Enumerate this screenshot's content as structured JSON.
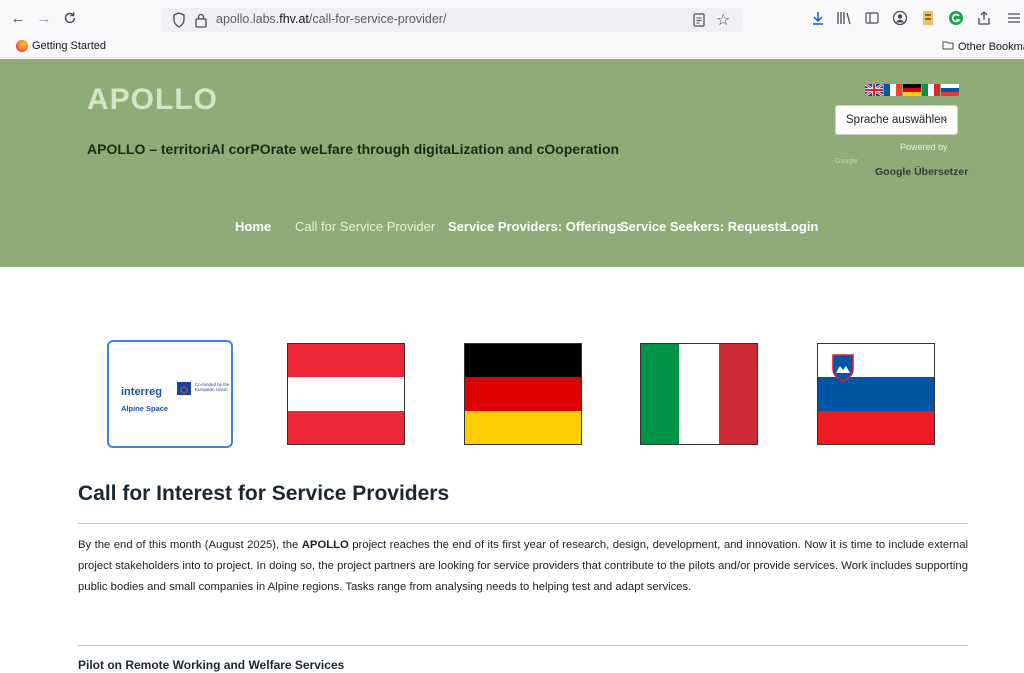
{
  "browser": {
    "url_prefix": "apollo.labs.",
    "url_domain": "fhv.at",
    "url_path": "/call-for-service-provider/",
    "back_icon": "arrow-left-icon",
    "forward_icon": "arrow-right-icon",
    "reload_icon": "reload-icon",
    "bookmarks": {
      "getting_started": "Getting Started",
      "other_bookmarks": "Other Bookmarks"
    }
  },
  "site": {
    "title": "APOLLO",
    "tagline": "APOLLO – territoriAl corPOrate weLfare through digitaLization and cOoperation",
    "language_select": "Sprache auswählen",
    "powered_by": "Powered by",
    "google_logo": "Google",
    "google_translate": "Google Übersetzer",
    "nav": [
      {
        "label": "Home"
      },
      {
        "label": "Call for Service Provider",
        "active": true
      },
      {
        "label": "Service Providers: Offerings"
      },
      {
        "label": "Service Seekers: Requests"
      },
      {
        "label": "Login"
      }
    ],
    "colors": {
      "header_bg": "#8fab78",
      "title": "#d6e4c8",
      "accent_border": "#3f86d9"
    }
  },
  "logos": {
    "interreg": "interreg",
    "cofunded": "Co-funded by the European Union",
    "alpine_space": "Alpine Space"
  },
  "content": {
    "title": "Call for Interest for Service Providers",
    "para_start": "By the end of this month (August 2025), the ",
    "para_bold": "APOLLO",
    "para_end": " project reaches the end of its first year of research, design, development, and innovation. Now it is time to include external project stakeholders into to project. In doing so, the project partners are looking for service providers that contribute to the pilots and/or provide services. Work includes supporting public bodies and small companies in Alpine regions. Tasks range from analysing needs to helping test and adapt services.",
    "subheading": "Pilot on Remote Working and Welfare Services"
  }
}
